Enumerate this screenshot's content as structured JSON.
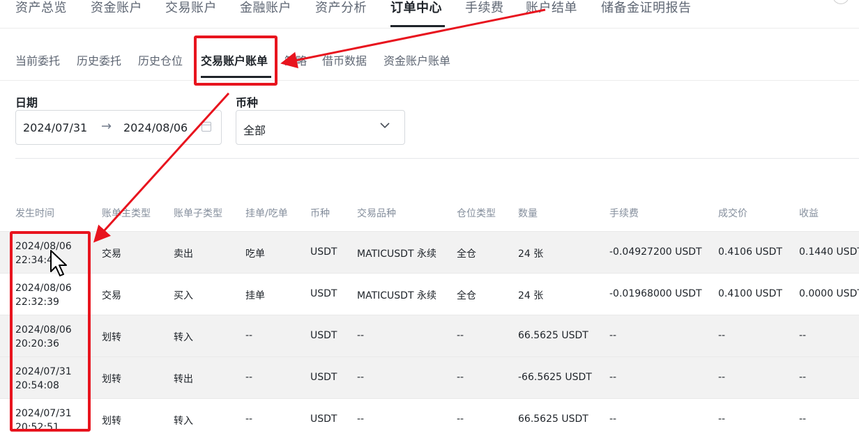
{
  "top_nav": [
    {
      "label": "资产总览"
    },
    {
      "label": "资金账户"
    },
    {
      "label": "交易账户"
    },
    {
      "label": "金融账户"
    },
    {
      "label": "资产分析"
    },
    {
      "label": "订单中心"
    },
    {
      "label": "手续费"
    },
    {
      "label": "账户结单"
    },
    {
      "label": "储备金证明报告"
    }
  ],
  "sub_tabs": [
    {
      "label": "当前委托"
    },
    {
      "label": "历史委托"
    },
    {
      "label": "历史仓位"
    },
    {
      "label": "交易账户账单"
    },
    {
      "label": "策略"
    },
    {
      "label": "借币数据"
    },
    {
      "label": "资金账户账单"
    }
  ],
  "filters": {
    "date_label": "日期",
    "date_from": "2024/07/31",
    "date_arrow": "→",
    "date_to": "2024/08/06",
    "currency_label": "币种",
    "currency_value": "全部"
  },
  "table": {
    "headers": [
      "发生时间",
      "账单主类型",
      "账单子类型",
      "挂单/吃单",
      "币种",
      "交易品种",
      "仓位类型",
      "数量",
      "手续费",
      "成交价",
      "收益"
    ],
    "rows": [
      {
        "date": "2024/08/06",
        "time": "22:34:4",
        "main_type": "交易",
        "sub_type": "卖出",
        "maker_taker": "吃单",
        "currency": "USDT",
        "instrument": "MATICUSDT 永续",
        "position_type": "全仓",
        "amount": "24 张",
        "fee": "-0.04927200 USDT",
        "price": "0.4106 USDT",
        "pnl": "0.1440 USDT"
      },
      {
        "date": "2024/08/06",
        "time": "22:32:39",
        "main_type": "交易",
        "sub_type": "买入",
        "maker_taker": "挂单",
        "currency": "USDT",
        "instrument": "MATICUSDT 永续",
        "position_type": "全仓",
        "amount": "24 张",
        "fee": "-0.01968000 USDT",
        "price": "0.4100 USDT",
        "pnl": "0.0000 USDT"
      },
      {
        "date": "2024/08/06",
        "time": "20:20:36",
        "main_type": "划转",
        "sub_type": "转入",
        "maker_taker": "--",
        "currency": "USDT",
        "instrument": "--",
        "position_type": "--",
        "amount": "66.5625 USDT",
        "fee": "--",
        "price": "--",
        "pnl": "--"
      },
      {
        "date": "2024/07/31",
        "time": "20:54:08",
        "main_type": "划转",
        "sub_type": "转出",
        "maker_taker": "--",
        "currency": "USDT",
        "instrument": "--",
        "position_type": "--",
        "amount": "-66.5625 USDT",
        "fee": "--",
        "price": "--",
        "pnl": "--"
      },
      {
        "date": "2024/07/31",
        "time": "20:52:51",
        "main_type": "划转",
        "sub_type": "转入",
        "maker_taker": "--",
        "currency": "USDT",
        "instrument": "--",
        "position_type": "--",
        "amount": "66.5625 USDT",
        "fee": "--",
        "price": "--",
        "pnl": "--"
      }
    ]
  },
  "colors": {
    "annotation_red": "#e8141e",
    "text_primary": "#1e2329",
    "text_secondary": "#5e6673",
    "row_shade": "#f2f2f2"
  }
}
